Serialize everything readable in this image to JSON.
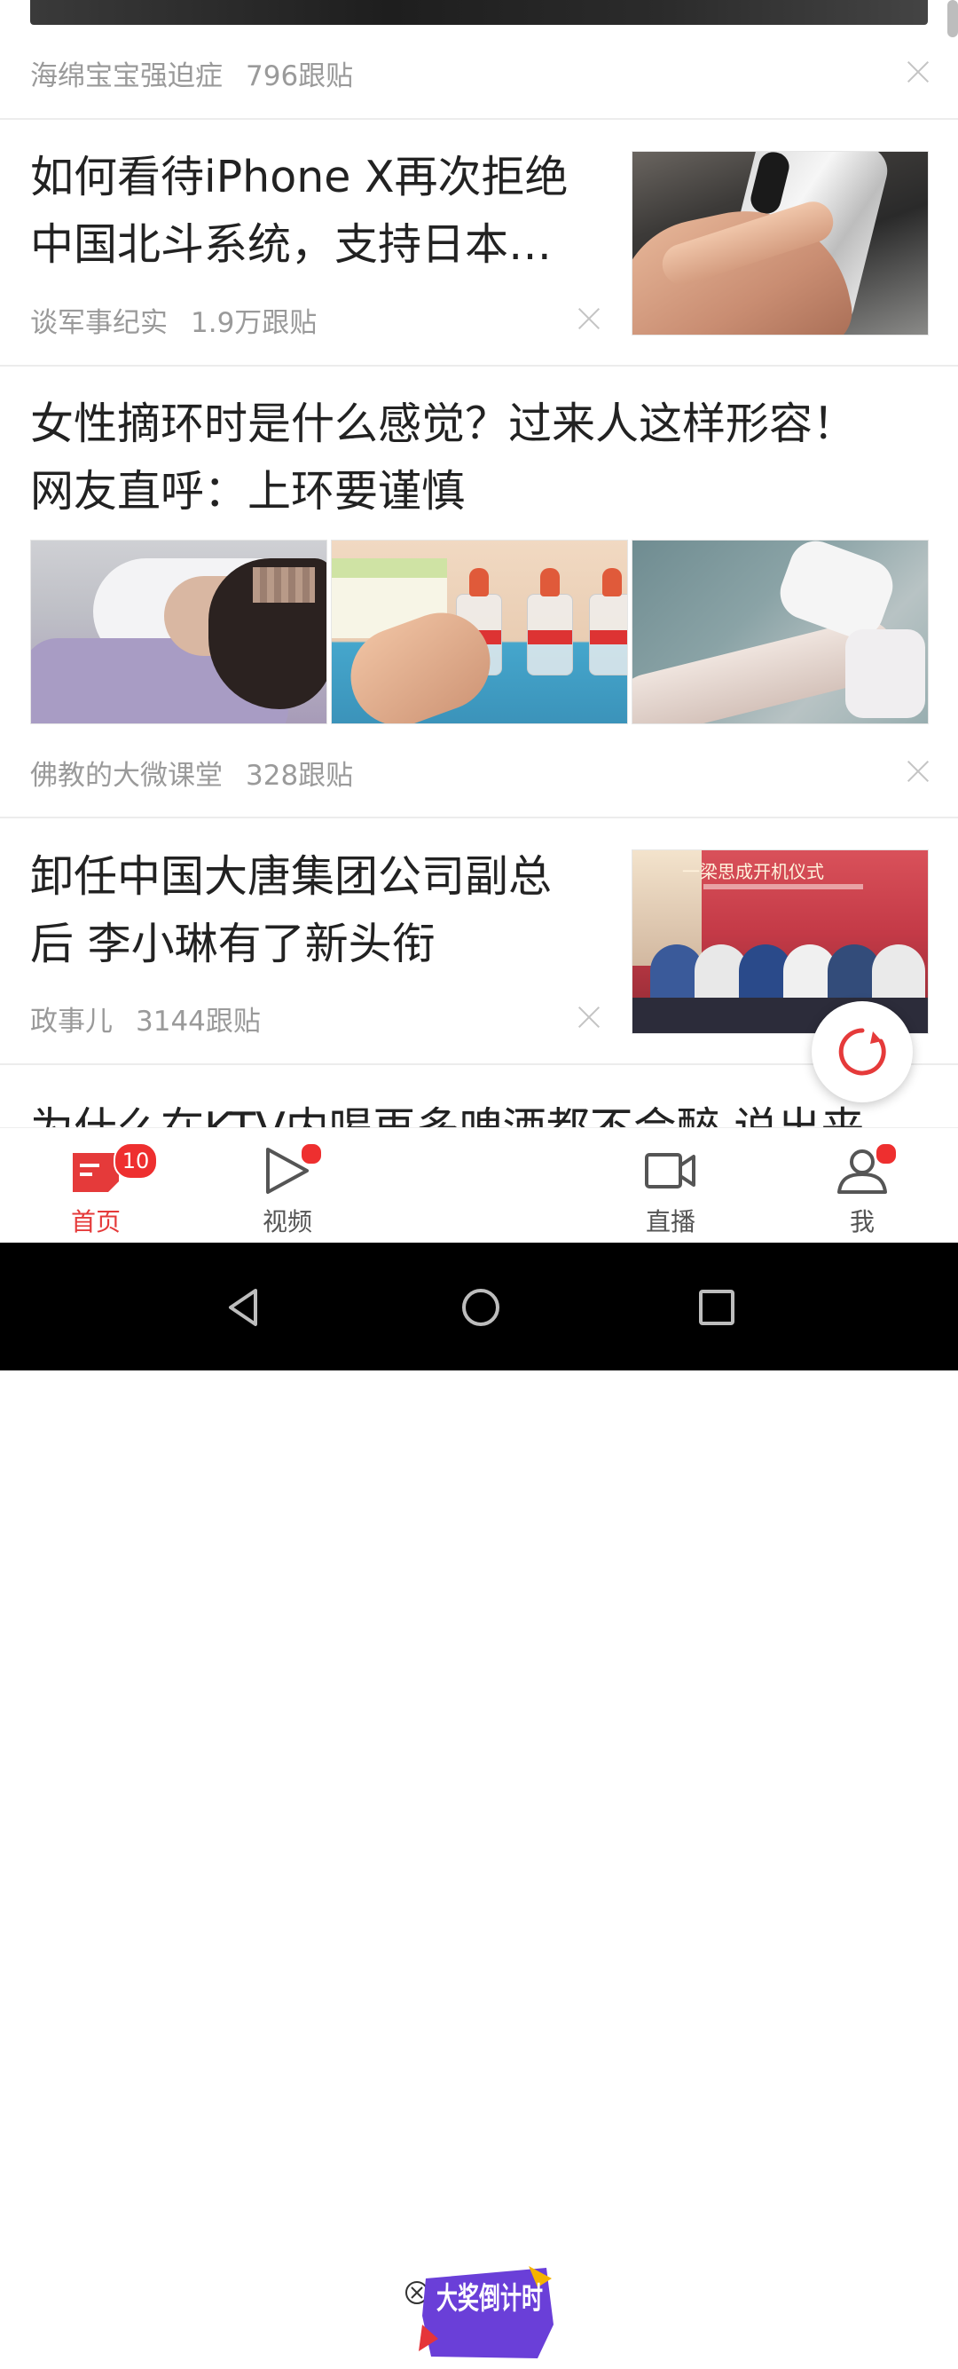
{
  "feed": {
    "items": [
      {
        "source": "海绵宝宝强迫症",
        "replies": "796跟贴"
      },
      {
        "title_line1": "如何看待iPhone X再次拒绝",
        "title_line2": "中国北斗系统，支持日本…",
        "source": "谈军事纪实",
        "replies": "1.9万跟贴"
      },
      {
        "title_line1": "女性摘环时是什么感觉？过来人这样形容！",
        "title_line2": "网友直呼：上环要谨慎",
        "source": "佛教的大微课堂",
        "replies": "328跟贴"
      },
      {
        "title_line1": "卸任中国大唐集团公司副总",
        "title_line2": "后 李小琳有了新头衔",
        "source": "政事儿",
        "replies": "3144跟贴",
        "image_caption": "一梁思成开机仪式"
      },
      {
        "title_partial": "为什么在KTV内喝再多啤酒都不会醉 说出来"
      }
    ]
  },
  "tabbar": {
    "tabs": [
      {
        "label": "首页",
        "badge": "10",
        "icon": "news-icon"
      },
      {
        "label": "视频",
        "icon": "play-icon"
      },
      {
        "label": "直播",
        "icon": "video-camera-icon"
      },
      {
        "label": "我",
        "icon": "user-icon"
      }
    ],
    "promo_text": "大奖倒计时"
  },
  "colors": {
    "accent": "#e53a3a",
    "badge": "#ee2f2f",
    "meta_text": "#9a9a9a"
  }
}
